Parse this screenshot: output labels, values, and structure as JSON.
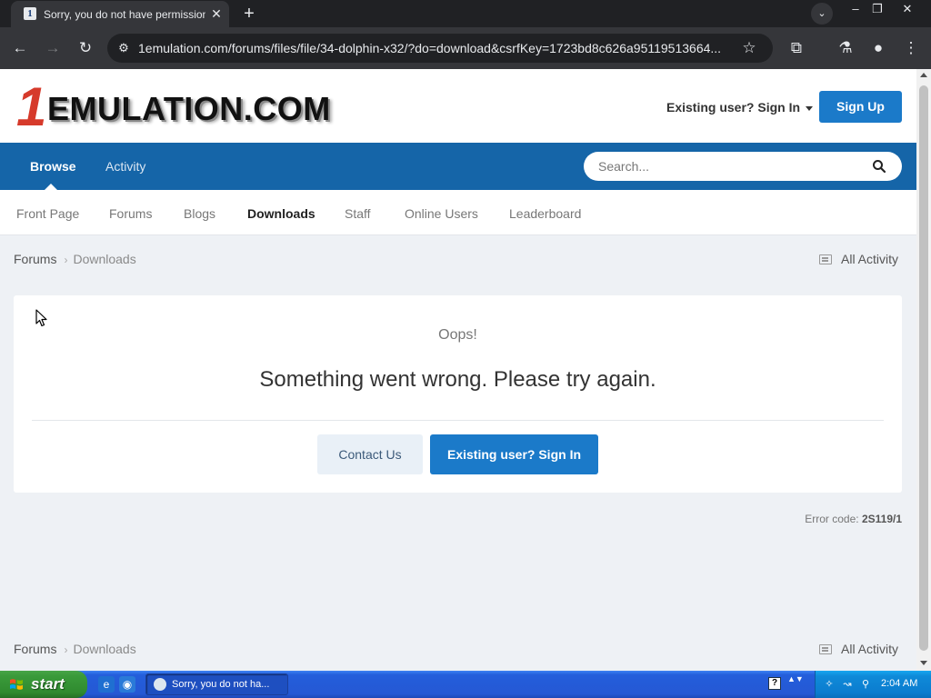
{
  "browser": {
    "tab": {
      "favicon": "1",
      "title": "Sorry, you do not have permission",
      "close_icon": "✕"
    },
    "new_tab_icon": "+",
    "tab_search_icon": "⌄",
    "window_controls": {
      "minimize": "–",
      "restore": "❐",
      "close": "✕"
    },
    "toolbar": {
      "back_icon": "←",
      "forward_icon": "→",
      "reload_icon": "↻",
      "site_info_icon": "⚙",
      "url": "1emulation.com/forums/files/file/34-dolphin-x32/?do=download&csrfKey=1723bd8c626a95119513664...",
      "bookmark_icon": "☆",
      "extensions_icon": "⧉",
      "labs_icon": "⚗",
      "profile_icon": "●",
      "menu_icon": "⋮"
    }
  },
  "site": {
    "logo": {
      "one": "1",
      "text": "EMULATION.COM"
    },
    "signin_link": "Existing user? Sign In",
    "signup_button": "Sign Up",
    "nav": {
      "browse": "Browse",
      "activity": "Activity"
    },
    "search_placeholder": "Search...",
    "subnav": [
      "Front Page",
      "Forums",
      "Blogs",
      "Downloads",
      "Staff",
      "Online Users",
      "Leaderboard"
    ],
    "subnav_active": "Downloads",
    "breadcrumb": {
      "first": "Forums",
      "separator": "›",
      "second": "Downloads"
    },
    "all_activity": "All Activity"
  },
  "error": {
    "oops": "Oops!",
    "message": "Something went wrong. Please try again.",
    "contact_button": "Contact Us",
    "signin_button": "Existing user? Sign In",
    "code_label": "Error code:",
    "code_value": "2S119/1"
  },
  "taskbar": {
    "start": "start",
    "task_label": "Sorry, you do not ha...",
    "help_icon": "?",
    "tray_arrows": "▲▼",
    "tray_icons": [
      "✧",
      "↝",
      "⚲"
    ],
    "clock": "2:04 AM"
  },
  "colors": {
    "brand_blue": "#1565a8",
    "button_blue": "#1b7ac9",
    "logo_red": "#d63a2b",
    "page_bg": "#eef1f5"
  }
}
